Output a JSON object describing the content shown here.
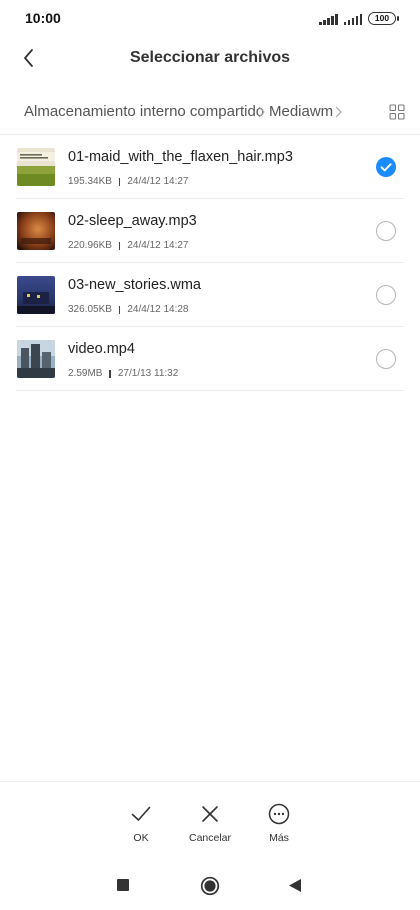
{
  "status_bar": {
    "time": "10:00",
    "battery": "100"
  },
  "header": {
    "title": "Seleccionar archivos",
    "back_icon": "chevron-left-icon"
  },
  "breadcrumb": {
    "items": [
      "Almacenamiento interno compartido",
      "Mediawm"
    ],
    "view_toggle_icon": "grid-view-icon"
  },
  "files": [
    {
      "name": "01-maid_with_the_flaxen_hair.mp3",
      "size": "195.34KB",
      "date": "24/4/12 14:27",
      "selected": true
    },
    {
      "name": "02-sleep_away.mp3",
      "size": "220.96KB",
      "date": "24/4/12 14:27",
      "selected": false
    },
    {
      "name": "03-new_stories.wma",
      "size": "326.05KB",
      "date": "24/4/12 14:28",
      "selected": false
    },
    {
      "name": "video.mp4",
      "size": "2.59MB",
      "date": "27/1/13 11:32",
      "selected": false
    }
  ],
  "toolbar": {
    "ok_label": "OK",
    "cancel_label": "Cancelar",
    "more_label": "Más"
  },
  "colors": {
    "accent": "#1a8cff"
  }
}
